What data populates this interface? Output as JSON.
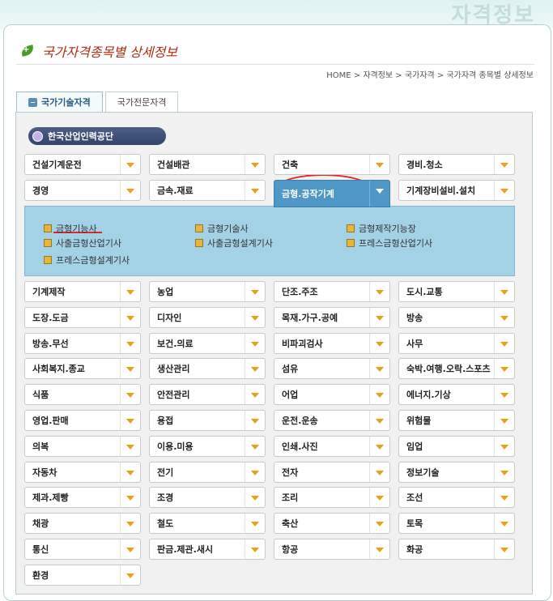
{
  "header": {
    "corner_title": "자격정보",
    "page_title": "국가자격종목별 상세정보",
    "breadcrumb": [
      "HOME",
      "자격정보",
      "국가자격",
      "국가자격 종목별 상세정보"
    ]
  },
  "tabs": [
    {
      "label": "국가기술자격",
      "active": true
    },
    {
      "label": "국가전문자격",
      "active": false
    }
  ],
  "agency": "한국산업인력공단",
  "selected_category": "금형.공작기계",
  "categories_top": [
    "건설기계운전",
    "건설배관",
    "건축",
    "경비.청소",
    "경영",
    "금속.재료",
    "금형.공작기계",
    "기계장비설비.설치"
  ],
  "subcategories": [
    "금형기능사",
    "금형기술사",
    "금형제작기능장",
    "사출금형산업기사",
    "사출금형설계기사",
    "프레스금형산업기사",
    "프레스금형설계기사"
  ],
  "categories_rest": [
    "기계제작",
    "농업",
    "단조.주조",
    "도시.교통",
    "도장.도금",
    "디자인",
    "목재.가구.공예",
    "방송",
    "방송.무선",
    "보건.의료",
    "비파괴검사",
    "사무",
    "사회복지.종교",
    "생산관리",
    "섬유",
    "숙박.여행.오락.스포츠",
    "식품",
    "안전관리",
    "어업",
    "에너지.기상",
    "영업.판매",
    "용접",
    "운전.운송",
    "위험물",
    "의복",
    "이용.미용",
    "인쇄.사진",
    "임업",
    "자동차",
    "전기",
    "전자",
    "정보기술",
    "제과.제빵",
    "조경",
    "조리",
    "조선",
    "채광",
    "철도",
    "축산",
    "토목",
    "통신",
    "판금.제관.새시",
    "항공",
    "화공",
    "환경"
  ],
  "colors": {
    "accent_blue": "#4f97c6",
    "arrow_orange": "#e7a21b",
    "highlight_red": "#e0262b",
    "subpanel_bg": "#a3d1e6"
  }
}
